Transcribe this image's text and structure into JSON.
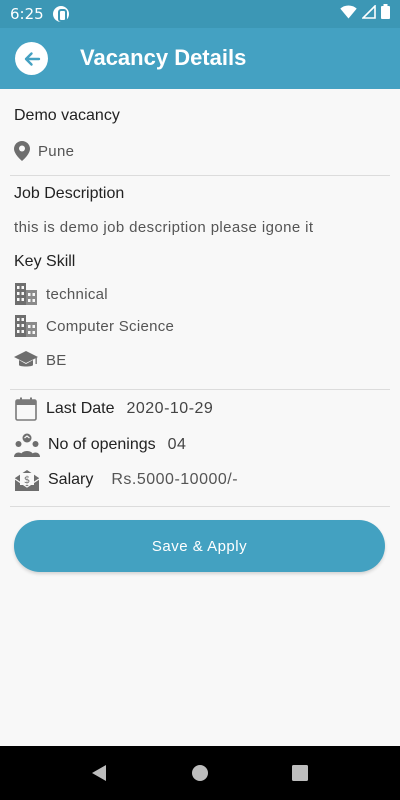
{
  "status_bar": {
    "time": "6:25"
  },
  "app_bar": {
    "title": "Vacancy Details"
  },
  "vacancy": {
    "title": "Demo vacancy",
    "location": "Pune",
    "job_description_heading": "Job Description",
    "job_description": "this is demo job description please igone it",
    "key_skill_heading": "Key Skill",
    "skills": [
      "technical",
      "Computer Science",
      "BE"
    ],
    "last_date_label": "Last Date",
    "last_date": "2020-10-29",
    "openings_label": "No of openings",
    "openings": "04",
    "salary_label": "Salary",
    "salary": "Rs.5000-10000/-"
  },
  "actions": {
    "apply_label": "Save  & Apply"
  },
  "colors": {
    "primary": "#44a1c2",
    "status_bar": "#3c97b5",
    "icon": "#6e6e6e"
  }
}
